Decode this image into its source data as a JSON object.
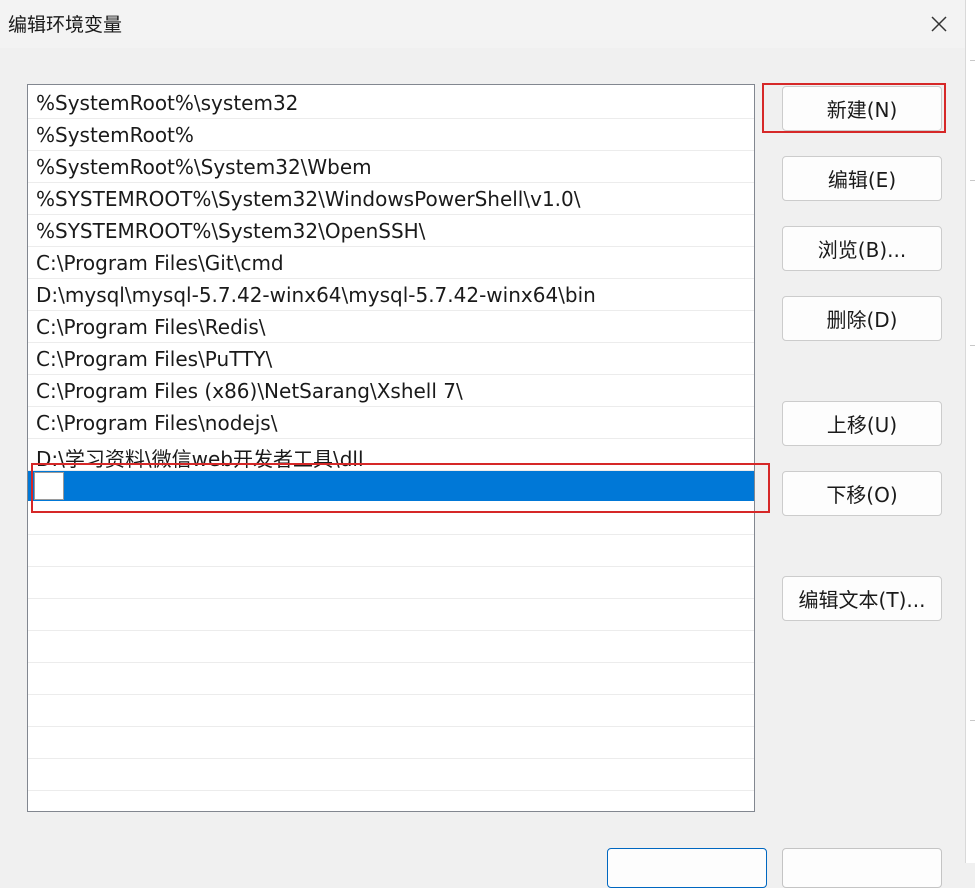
{
  "window": {
    "title": "编辑环境变量"
  },
  "paths": [
    "%SystemRoot%\\system32",
    "%SystemRoot%",
    "%SystemRoot%\\System32\\Wbem",
    "%SYSTEMROOT%\\System32\\WindowsPowerShell\\v1.0\\",
    "%SYSTEMROOT%\\System32\\OpenSSH\\",
    "C:\\Program Files\\Git\\cmd",
    "D:\\mysql\\mysql-5.7.42-winx64\\mysql-5.7.42-winx64\\bin",
    "C:\\Program Files\\Redis\\",
    "C:\\Program Files\\PuTTY\\",
    "C:\\Program Files (x86)\\NetSarang\\Xshell 7\\",
    "C:\\Program Files\\nodejs\\",
    "D:\\学习资料\\微信web开发者工具\\dll"
  ],
  "new_entry": {
    "value": ""
  },
  "buttons": {
    "new": "新建(N)",
    "edit": "编辑(E)",
    "browse": "浏览(B)...",
    "delete": "删除(D)",
    "move_up": "上移(U)",
    "move_down": "下移(O)",
    "edit_text": "编辑文本(T)..."
  },
  "colors": {
    "selection": "#0078d7",
    "highlight_box": "#d62828"
  },
  "icons": {
    "close": "close-icon"
  }
}
